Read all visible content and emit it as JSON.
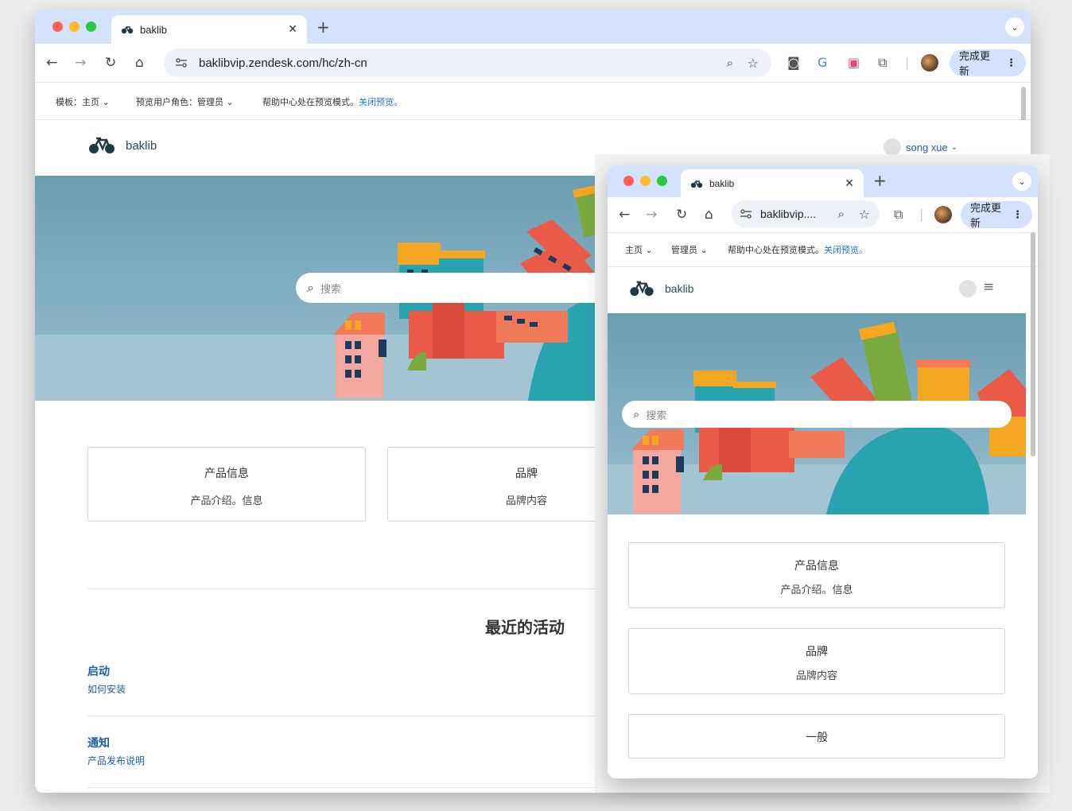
{
  "window_a": {
    "tab_title": "baklib",
    "url": "baklibvip.zendesk.com/hc/zh-cn",
    "update_button": "完成更新",
    "preview_bar": {
      "template_label": "模板：",
      "template_value": "主页",
      "role_label": "预览用户角色：",
      "role_value": "管理员",
      "status_text": "帮助中心处在预览模式。",
      "close_link": "关闭预览。"
    },
    "brand": "baklib",
    "user_name": "song xue",
    "search_placeholder": "搜索",
    "cards": [
      {
        "title": "产品信息",
        "subtitle": "产品介绍。信息"
      },
      {
        "title": "品牌",
        "subtitle": "品牌内容"
      }
    ],
    "recent_activity_title": "最近的活动",
    "activities": [
      {
        "title": "启动",
        "subtitle": "如何安装"
      },
      {
        "title": "通知",
        "subtitle": "产品发布说明"
      }
    ]
  },
  "window_b": {
    "tab_title": "baklib",
    "url": "baklibvip....",
    "update_button": "完成更新",
    "preview_bar": {
      "template_value": "主页",
      "role_value": "管理员",
      "status_text": "帮助中心处在预览模式。",
      "close_link": "关闭预览。"
    },
    "brand": "baklib",
    "search_placeholder": "搜索",
    "cards": [
      {
        "title": "产品信息",
        "subtitle": "产品介绍。信息"
      },
      {
        "title": "品牌",
        "subtitle": "品牌内容"
      },
      {
        "title": "一般"
      }
    ]
  },
  "colors": {
    "tab_strip": "#d3e3fd",
    "link_blue": "#1a73e8",
    "activity_blue": "#1d5fa8",
    "hero_sky": "#6c9db3"
  }
}
